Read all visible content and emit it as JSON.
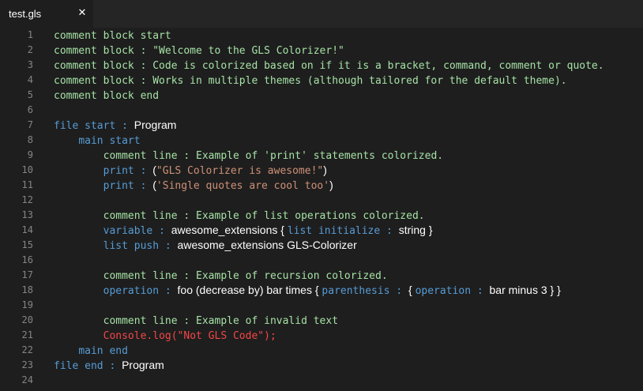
{
  "tab": {
    "label": "test.gls",
    "close_glyph": "✕",
    "close_icon": "close-icon"
  },
  "colors": {
    "comment": "#a6e2a6",
    "keyword": "#569cd6",
    "text": "#ffffff",
    "string": "#ce9178",
    "invalid": "#f44747",
    "line_number": "#858585",
    "background": "#1e1e1e"
  },
  "editor": {
    "lines": [
      {
        "number": "1",
        "indent": "",
        "tokens": [
          {
            "t": "comment block start",
            "k": "comment"
          }
        ]
      },
      {
        "number": "2",
        "indent": "",
        "tokens": [
          {
            "t": "comment block : \"Welcome to the GLS Colorizer!\"",
            "k": "comment"
          }
        ]
      },
      {
        "number": "3",
        "indent": "",
        "tokens": [
          {
            "t": "comment block : Code is colorized based on if it is a bracket, command, comment or quote.",
            "k": "comment"
          }
        ]
      },
      {
        "number": "4",
        "indent": "",
        "tokens": [
          {
            "t": "comment block : Works in multiple themes (although tailored for the default theme).",
            "k": "comment"
          }
        ]
      },
      {
        "number": "5",
        "indent": "",
        "tokens": [
          {
            "t": "comment block end",
            "k": "comment"
          }
        ]
      },
      {
        "number": "6",
        "indent": "",
        "tokens": []
      },
      {
        "number": "7",
        "indent": "",
        "tokens": [
          {
            "t": "file start : ",
            "k": "keyword"
          },
          {
            "t": "Program",
            "k": "text"
          }
        ]
      },
      {
        "number": "8",
        "indent": "    ",
        "tokens": [
          {
            "t": "main start",
            "k": "keyword"
          }
        ]
      },
      {
        "number": "9",
        "indent": "        ",
        "tokens": [
          {
            "t": "comment line : Example of 'print' statements colorized.",
            "k": "comment"
          }
        ]
      },
      {
        "number": "10",
        "indent": "        ",
        "tokens": [
          {
            "t": "print : ",
            "k": "keyword"
          },
          {
            "t": "(",
            "k": "text"
          },
          {
            "t": "\"GLS Colorizer is awesome!\"",
            "k": "string"
          },
          {
            "t": ")",
            "k": "text"
          }
        ]
      },
      {
        "number": "11",
        "indent": "        ",
        "tokens": [
          {
            "t": "print : ",
            "k": "keyword"
          },
          {
            "t": "(",
            "k": "text"
          },
          {
            "t": "'Single quotes are cool too'",
            "k": "string"
          },
          {
            "t": ")",
            "k": "text"
          }
        ]
      },
      {
        "number": "12",
        "indent": "",
        "tokens": []
      },
      {
        "number": "13",
        "indent": "        ",
        "tokens": [
          {
            "t": "comment line : Example of list operations colorized.",
            "k": "comment"
          }
        ]
      },
      {
        "number": "14",
        "indent": "        ",
        "tokens": [
          {
            "t": "variable : ",
            "k": "keyword"
          },
          {
            "t": "awesome_extensions { ",
            "k": "text"
          },
          {
            "t": "list initialize : ",
            "k": "keyword"
          },
          {
            "t": "string }",
            "k": "text"
          }
        ]
      },
      {
        "number": "15",
        "indent": "        ",
        "tokens": [
          {
            "t": "list push : ",
            "k": "keyword"
          },
          {
            "t": "awesome_extensions GLS-Colorizer",
            "k": "text"
          }
        ]
      },
      {
        "number": "16",
        "indent": "",
        "tokens": []
      },
      {
        "number": "17",
        "indent": "        ",
        "tokens": [
          {
            "t": "comment line : Example of recursion colorized.",
            "k": "comment"
          }
        ]
      },
      {
        "number": "18",
        "indent": "        ",
        "tokens": [
          {
            "t": "operation : ",
            "k": "keyword"
          },
          {
            "t": "foo (decrease by) bar times { ",
            "k": "text"
          },
          {
            "t": "parenthesis : ",
            "k": "keyword"
          },
          {
            "t": "{ ",
            "k": "text"
          },
          {
            "t": "operation : ",
            "k": "keyword"
          },
          {
            "t": "bar minus 3 } }",
            "k": "text"
          }
        ]
      },
      {
        "number": "19",
        "indent": "",
        "tokens": []
      },
      {
        "number": "20",
        "indent": "        ",
        "tokens": [
          {
            "t": "comment line : Example of invalid text",
            "k": "comment"
          }
        ]
      },
      {
        "number": "21",
        "indent": "        ",
        "tokens": [
          {
            "t": "Console.log(\"Not GLS Code\");",
            "k": "invalid"
          }
        ]
      },
      {
        "number": "22",
        "indent": "    ",
        "tokens": [
          {
            "t": "main end",
            "k": "keyword"
          }
        ]
      },
      {
        "number": "23",
        "indent": "",
        "tokens": [
          {
            "t": "file end : ",
            "k": "keyword"
          },
          {
            "t": "Program",
            "k": "text"
          }
        ]
      },
      {
        "number": "24",
        "indent": "",
        "tokens": []
      }
    ]
  }
}
